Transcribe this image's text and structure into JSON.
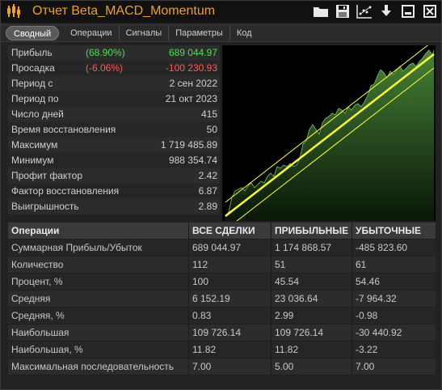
{
  "window": {
    "title": "Отчет Beta_MACD_Momentum"
  },
  "toolbar": {
    "icons": [
      "folder-icon",
      "save-icon",
      "chart-icon",
      "download-icon",
      "minimize-icon",
      "close-icon"
    ]
  },
  "tabs": [
    {
      "label": "Сводный",
      "active": true
    },
    {
      "label": "Операции",
      "active": false
    },
    {
      "label": "Сигналы",
      "active": false
    },
    {
      "label": "Параметры",
      "active": false
    },
    {
      "label": "Код",
      "active": false
    }
  ],
  "summary": {
    "profit": {
      "label": "Прибыль",
      "pct": "(68.90%)",
      "value": "689 044.97"
    },
    "drawdown": {
      "label": "Просадка",
      "pct": "(-6.06%)",
      "value": "-100 230.93"
    },
    "period_from": {
      "label": "Период с",
      "value": "2 сен 2022"
    },
    "period_to": {
      "label": "Период по",
      "value": "21 окт 2023"
    },
    "days": {
      "label": "Число дней",
      "value": "415"
    },
    "recovery_time": {
      "label": "Время восстановления",
      "value": "50"
    },
    "maximum": {
      "label": "Максимум",
      "value": "1 719 485.89"
    },
    "minimum": {
      "label": "Минимум",
      "value": "988 354.74"
    },
    "profit_factor": {
      "label": "Профит фактор",
      "value": "2.42"
    },
    "recovery_factor": {
      "label": "Фактор восстановления",
      "value": "6.87"
    },
    "win_rate": {
      "label": "Выигрышность",
      "value": "2.89"
    }
  },
  "colors": {
    "accent": "#f0a020",
    "positive": "#4ce04c",
    "negative": "#ff5a5a",
    "regression": "#ffff33",
    "equity_fill": "#3a6a2a"
  },
  "operations": {
    "headers": [
      "Операции",
      "ВСЕ СДЕЛКИ",
      "ПРИБЫЛЬНЫЕ",
      "УБЫТОЧНЫЕ"
    ],
    "rows": [
      [
        "Суммарная Прибыль/Убыток",
        "689 044.97",
        "1 174 868.57",
        "-485 823.60"
      ],
      [
        "Количество",
        "112",
        "51",
        "61"
      ],
      [
        "Процент, %",
        "100",
        "45.54",
        "54.46"
      ],
      [
        "Средняя",
        "6 152.19",
        "23 036.64",
        "-7 964.32"
      ],
      [
        "Средняя, %",
        "0.83",
        "2.99",
        "-0.98"
      ],
      [
        "Наибольшая",
        "109 726.14",
        "109 726.14",
        "-30 440.92"
      ],
      [
        "Наибольшая, %",
        "11.82",
        "11.82",
        "-3.22"
      ],
      [
        "Максимальная последовательность",
        "7.00",
        "5.00",
        "7.00"
      ]
    ]
  }
}
